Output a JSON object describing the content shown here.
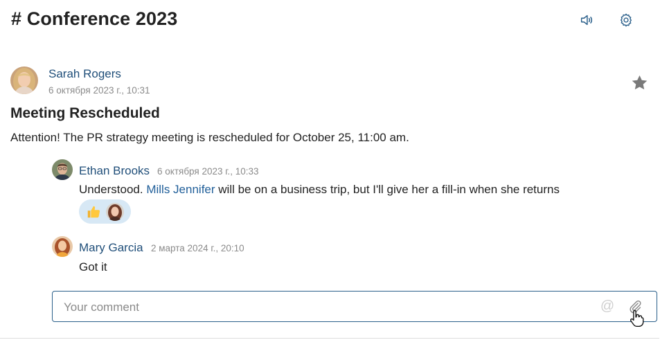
{
  "header": {
    "title": "# Conference 2023",
    "icons": {
      "sound": "speaker-icon",
      "settings": "gear-icon"
    }
  },
  "post": {
    "author": "Sarah Rogers",
    "date": "6 октября 2023 г., 10:31",
    "title": "Meeting Rescheduled",
    "body": "Attention! The PR strategy meeting is rescheduled for October 25, 11:00 am.",
    "favorite_icon": "star-icon"
  },
  "comments": [
    {
      "author": "Ethan Brooks",
      "date": "6 октября 2023 г., 10:33",
      "text_before": "Understood. ",
      "mention": "Mills Jennifer",
      "text_after": " will be on a business trip, but I'll give her a fill-in when she returns",
      "reaction": {
        "emoji": "thumbs-up-icon"
      }
    },
    {
      "author": "Mary Garcia",
      "date": "2 марта 2024 г., 20:10",
      "text": "Got it"
    }
  ],
  "comment_box": {
    "placeholder": "Your comment",
    "at_symbol": "@",
    "icons": {
      "mention": "at-sign-icon",
      "attach": "paperclip-icon"
    }
  },
  "colors": {
    "link": "#1f4e79",
    "meta": "#8a8a8a",
    "reaction_bg": "#d7e8f5",
    "input_border": "#2a5f8a",
    "star": "#7a7a7a"
  }
}
